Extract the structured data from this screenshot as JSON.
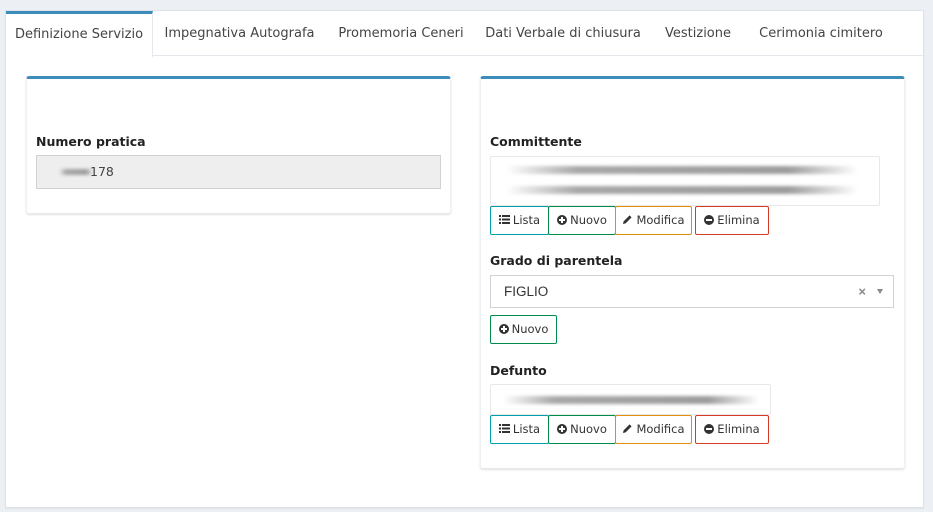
{
  "tabs": [
    {
      "label": "Definizione Servizio",
      "active": true
    },
    {
      "label": "Impegnativa Autografa",
      "active": false
    },
    {
      "label": "Promemoria Ceneri",
      "active": false
    },
    {
      "label": "Dati Verbale di chiusura",
      "active": false
    },
    {
      "label": "Vestizione",
      "active": false
    },
    {
      "label": "Cerimonia cimitero",
      "active": false
    }
  ],
  "left_panel": {
    "numero_pratica_label": "Numero pratica",
    "numero_pratica_value": "178"
  },
  "right_panel": {
    "committente_label": "Committente",
    "committente_buttons": {
      "lista": "Lista",
      "nuovo": "Nuovo",
      "modifica": "Modifica",
      "elimina": "Elimina"
    },
    "grado_label": "Grado di parentela",
    "grado_value": "FIGLIO",
    "grado_clear": "×",
    "grado_nuovo": "Nuovo",
    "defunto_label": "Defunto",
    "defunto_buttons": {
      "lista": "Lista",
      "nuovo": "Nuovo",
      "modifica": "Modifica",
      "elimina": "Elimina"
    }
  },
  "colors": {
    "tab_accent": "#3c8dbc",
    "btn_info": "#00a0b0",
    "btn_success": "#008d4c",
    "btn_warning": "#e08e0b",
    "btn_danger": "#d73925"
  }
}
